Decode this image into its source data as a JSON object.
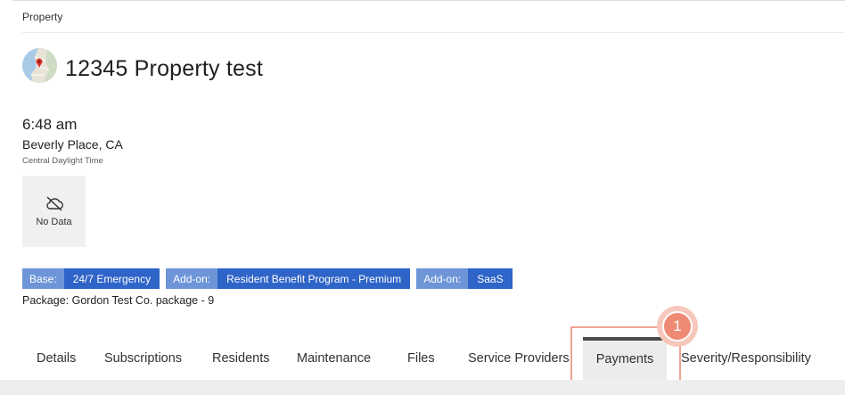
{
  "breadcrumb": {
    "label": "Property"
  },
  "property": {
    "title": "12345 Property test",
    "map_icon": "map-thumbnail",
    "local_time": "6:48 am",
    "location": "Beverly Place, CA",
    "timezone": "Central Daylight Time"
  },
  "weather": {
    "icon": "cloud-off-icon",
    "label": "No Data"
  },
  "badges": [
    {
      "key": "Base:",
      "value": "24/7 Emergency"
    },
    {
      "key": "Add-on:",
      "value": "Resident Benefit Program - Premium"
    },
    {
      "key": "Add-on:",
      "value": "SaaS"
    }
  ],
  "package": "Package: Gordon Test Co. package - 9",
  "tabs": [
    {
      "label": "Details"
    },
    {
      "label": "Subscriptions"
    },
    {
      "label": "Residents"
    },
    {
      "label": "Maintenance"
    },
    {
      "label": "Files"
    },
    {
      "label": "Service Providers"
    },
    {
      "label": "Payments",
      "active": true
    },
    {
      "label": "Severity/Responsibility"
    }
  ],
  "annotation": {
    "step": "1"
  },
  "colors": {
    "badge_key": "#6d95d8",
    "badge_value": "#2f64c8",
    "highlight": "#f0a294",
    "marker": "#ee8a74"
  }
}
